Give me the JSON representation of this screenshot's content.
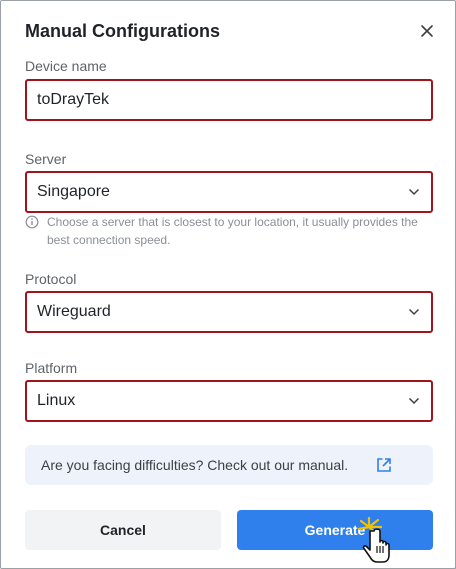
{
  "dialog": {
    "title": "Manual Configurations"
  },
  "device_name": {
    "label": "Device name",
    "value": "toDrayTek"
  },
  "server": {
    "label": "Server",
    "value": "Singapore",
    "hint": "Choose a server that is closest to your location, it usually provides the best connection speed."
  },
  "protocol": {
    "label": "Protocol",
    "value": "Wireguard"
  },
  "platform": {
    "label": "Platform",
    "value": "Linux"
  },
  "manual": {
    "text": "Are you facing difficulties? Check out our manual."
  },
  "actions": {
    "cancel_label": "Cancel",
    "generate_label": "Generate"
  },
  "colors": {
    "accent": "#2f80ed",
    "field_border": "#a0141e",
    "manual_bg": "#eef3fb"
  },
  "icons": [
    "close-icon",
    "chevron-down-icon",
    "info-icon",
    "external-link-icon",
    "pointer-cursor-icon"
  ]
}
